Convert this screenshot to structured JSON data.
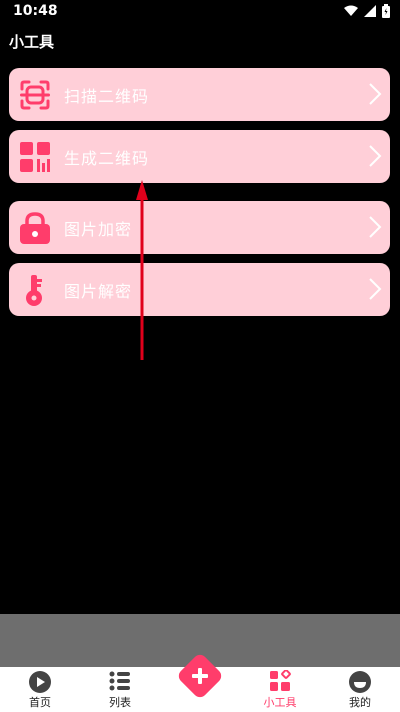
{
  "status_bar": {
    "time": "10:48"
  },
  "page": {
    "title": "小工具"
  },
  "tools": [
    {
      "label": "扫描二维码",
      "icon": "scan-qr-icon"
    },
    {
      "label": "生成二维码",
      "icon": "qr-grid-icon"
    },
    {
      "label": "图片加密",
      "icon": "lock-icon"
    },
    {
      "label": "图片解密",
      "icon": "key-icon"
    }
  ],
  "bottom_nav": {
    "items": [
      {
        "label": "首页",
        "icon": "play-icon"
      },
      {
        "label": "列表",
        "icon": "list-icon"
      },
      {
        "label": "",
        "icon": "add-icon"
      },
      {
        "label": "小工具",
        "icon": "tools-icon",
        "active": true
      },
      {
        "label": "我的",
        "icon": "profile-icon"
      }
    ]
  },
  "colors": {
    "accent": "#ff3d6b",
    "card": "#ffcfd8",
    "background": "#000000"
  }
}
